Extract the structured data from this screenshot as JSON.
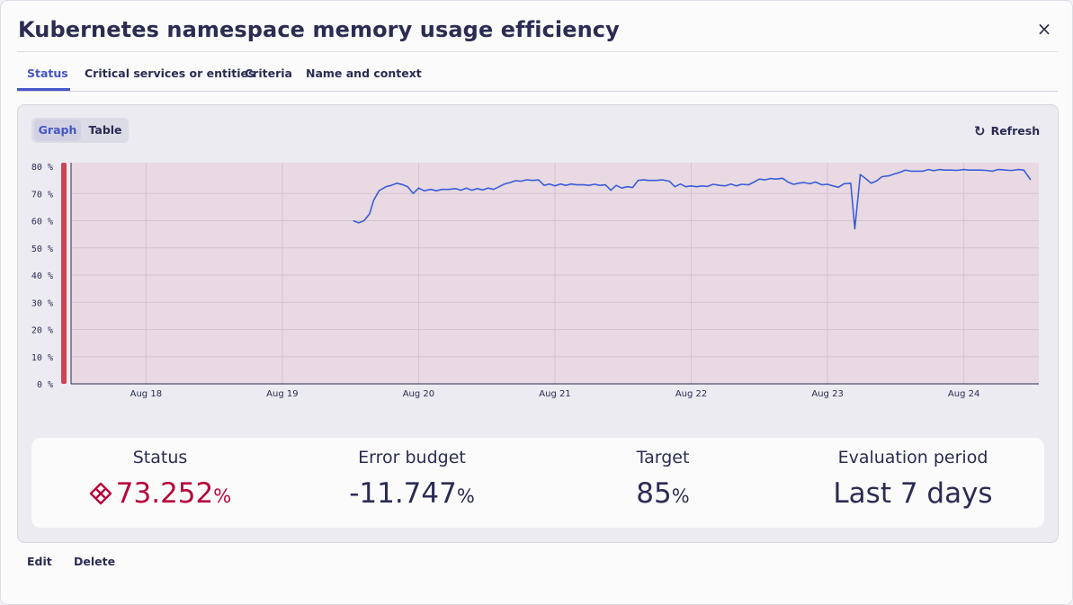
{
  "dialog": {
    "title": "Kubernetes namespace memory usage efficiency",
    "close_icon": "×"
  },
  "tabs": [
    {
      "label": "Status",
      "active": true
    },
    {
      "label": "Critical services or entities",
      "active": false
    },
    {
      "label": "Criteria",
      "active": false
    },
    {
      "label": "Name and context",
      "active": false
    }
  ],
  "view_toggle": {
    "graph_label": "Graph",
    "table_label": "Table",
    "selected": "Graph"
  },
  "refresh": {
    "label": "Refresh",
    "icon": "refresh-icon"
  },
  "chart_data": {
    "type": "line",
    "y_ticks": [
      "80 %",
      "70 %",
      "60 %",
      "50 %",
      "40 %",
      "30 %",
      "20 %",
      "10 %",
      "0 %"
    ],
    "x_ticks": [
      "Aug 18",
      "Aug 19",
      "Aug 20",
      "Aug 21",
      "Aug 22",
      "Aug 23",
      "Aug 24"
    ],
    "x_tick_days": [
      18,
      19,
      20,
      21,
      22,
      23,
      24
    ],
    "x_range_days": [
      17.45,
      24.55
    ],
    "ylim": [
      0,
      80
    ],
    "grid": true,
    "line_color": "#3b5ed8",
    "background_color": "#e8d9e2",
    "status_bar_color": "#cc4455",
    "series": [
      {
        "points": [
          [
            19.52,
            60.0
          ],
          [
            19.56,
            59.2
          ],
          [
            19.6,
            60.0
          ],
          [
            19.64,
            62.5
          ],
          [
            19.67,
            67.5
          ],
          [
            19.71,
            71.0
          ],
          [
            19.76,
            72.5
          ],
          [
            19.8,
            73.0
          ],
          [
            19.84,
            73.8
          ],
          [
            19.88,
            73.3
          ],
          [
            19.92,
            72.5
          ],
          [
            19.96,
            70.0
          ],
          [
            20.0,
            72.0
          ],
          [
            20.04,
            71.0
          ],
          [
            20.09,
            71.5
          ],
          [
            20.13,
            71.0
          ],
          [
            20.17,
            71.5
          ],
          [
            20.22,
            71.5
          ],
          [
            20.27,
            71.8
          ],
          [
            20.31,
            71.2
          ],
          [
            20.35,
            72.0
          ],
          [
            20.39,
            71.2
          ],
          [
            20.43,
            71.8
          ],
          [
            20.47,
            71.3
          ],
          [
            20.51,
            72.0
          ],
          [
            20.55,
            71.5
          ],
          [
            20.59,
            72.5
          ],
          [
            20.63,
            73.5
          ],
          [
            20.67,
            74.0
          ],
          [
            20.71,
            74.7
          ],
          [
            20.75,
            74.5
          ],
          [
            20.79,
            75.0
          ],
          [
            20.84,
            74.8
          ],
          [
            20.88,
            75.0
          ],
          [
            20.92,
            73.0
          ],
          [
            20.96,
            73.5
          ],
          [
            21.0,
            72.8
          ],
          [
            21.04,
            73.5
          ],
          [
            21.08,
            73.0
          ],
          [
            21.12,
            73.5
          ],
          [
            21.16,
            73.2
          ],
          [
            21.21,
            73.2
          ],
          [
            21.25,
            73.0
          ],
          [
            21.29,
            73.4
          ],
          [
            21.33,
            73.0
          ],
          [
            21.37,
            73.2
          ],
          [
            21.41,
            71.2
          ],
          [
            21.45,
            73.0
          ],
          [
            21.49,
            72.0
          ],
          [
            21.53,
            72.5
          ],
          [
            21.57,
            72.2
          ],
          [
            21.61,
            74.8
          ],
          [
            21.65,
            75.0
          ],
          [
            21.69,
            74.8
          ],
          [
            21.74,
            74.8
          ],
          [
            21.79,
            75.0
          ],
          [
            21.84,
            74.5
          ],
          [
            21.88,
            72.5
          ],
          [
            21.92,
            73.5
          ],
          [
            21.96,
            72.5
          ],
          [
            22.0,
            72.8
          ],
          [
            22.04,
            72.5
          ],
          [
            22.08,
            72.8
          ],
          [
            22.12,
            72.6
          ],
          [
            22.16,
            73.4
          ],
          [
            22.21,
            73.0
          ],
          [
            22.25,
            72.8
          ],
          [
            22.29,
            73.5
          ],
          [
            22.33,
            72.8
          ],
          [
            22.37,
            73.4
          ],
          [
            22.42,
            73.2
          ],
          [
            22.46,
            74.2
          ],
          [
            22.5,
            75.3
          ],
          [
            22.54,
            75.0
          ],
          [
            22.58,
            75.5
          ],
          [
            22.62,
            75.3
          ],
          [
            22.67,
            75.6
          ],
          [
            22.71,
            74.2
          ],
          [
            22.75,
            73.4
          ],
          [
            22.79,
            73.8
          ],
          [
            22.83,
            74.0
          ],
          [
            22.87,
            73.6
          ],
          [
            22.91,
            74.2
          ],
          [
            22.96,
            73.2
          ],
          [
            23.0,
            73.4
          ],
          [
            23.04,
            72.8
          ],
          [
            23.08,
            72.3
          ],
          [
            23.12,
            73.6
          ],
          [
            23.17,
            73.8
          ],
          [
            23.2,
            57.0
          ],
          [
            23.24,
            77.0
          ],
          [
            23.28,
            75.5
          ],
          [
            23.32,
            73.8
          ],
          [
            23.36,
            74.6
          ],
          [
            23.4,
            76.2
          ],
          [
            23.45,
            76.5
          ],
          [
            23.49,
            77.2
          ],
          [
            23.53,
            77.8
          ],
          [
            23.57,
            78.6
          ],
          [
            23.61,
            78.2
          ],
          [
            23.65,
            78.2
          ],
          [
            23.7,
            78.2
          ],
          [
            23.74,
            78.8
          ],
          [
            23.78,
            78.4
          ],
          [
            23.82,
            78.8
          ],
          [
            23.86,
            78.6
          ],
          [
            23.9,
            78.6
          ],
          [
            23.95,
            78.5
          ],
          [
            24.0,
            78.8
          ],
          [
            24.04,
            78.6
          ],
          [
            24.08,
            78.6
          ],
          [
            24.12,
            78.6
          ],
          [
            24.16,
            78.5
          ],
          [
            24.21,
            78.2
          ],
          [
            24.25,
            78.8
          ],
          [
            24.29,
            78.7
          ],
          [
            24.33,
            78.5
          ],
          [
            24.36,
            78.5
          ],
          [
            24.4,
            78.8
          ],
          [
            24.44,
            78.6
          ],
          [
            24.49,
            75.0
          ]
        ]
      }
    ]
  },
  "stats": [
    {
      "label": "Status",
      "value": "73.252",
      "unit": "%",
      "icon": "status-failure-icon",
      "color": "#b8063a"
    },
    {
      "label": "Error budget",
      "value": "-11.747",
      "unit": "%"
    },
    {
      "label": "Target",
      "value": "85",
      "unit": "%"
    },
    {
      "label": "Evaluation period",
      "value": "Last 7 days",
      "unit": ""
    }
  ],
  "footer": {
    "edit_label": "Edit",
    "delete_label": "Delete"
  }
}
